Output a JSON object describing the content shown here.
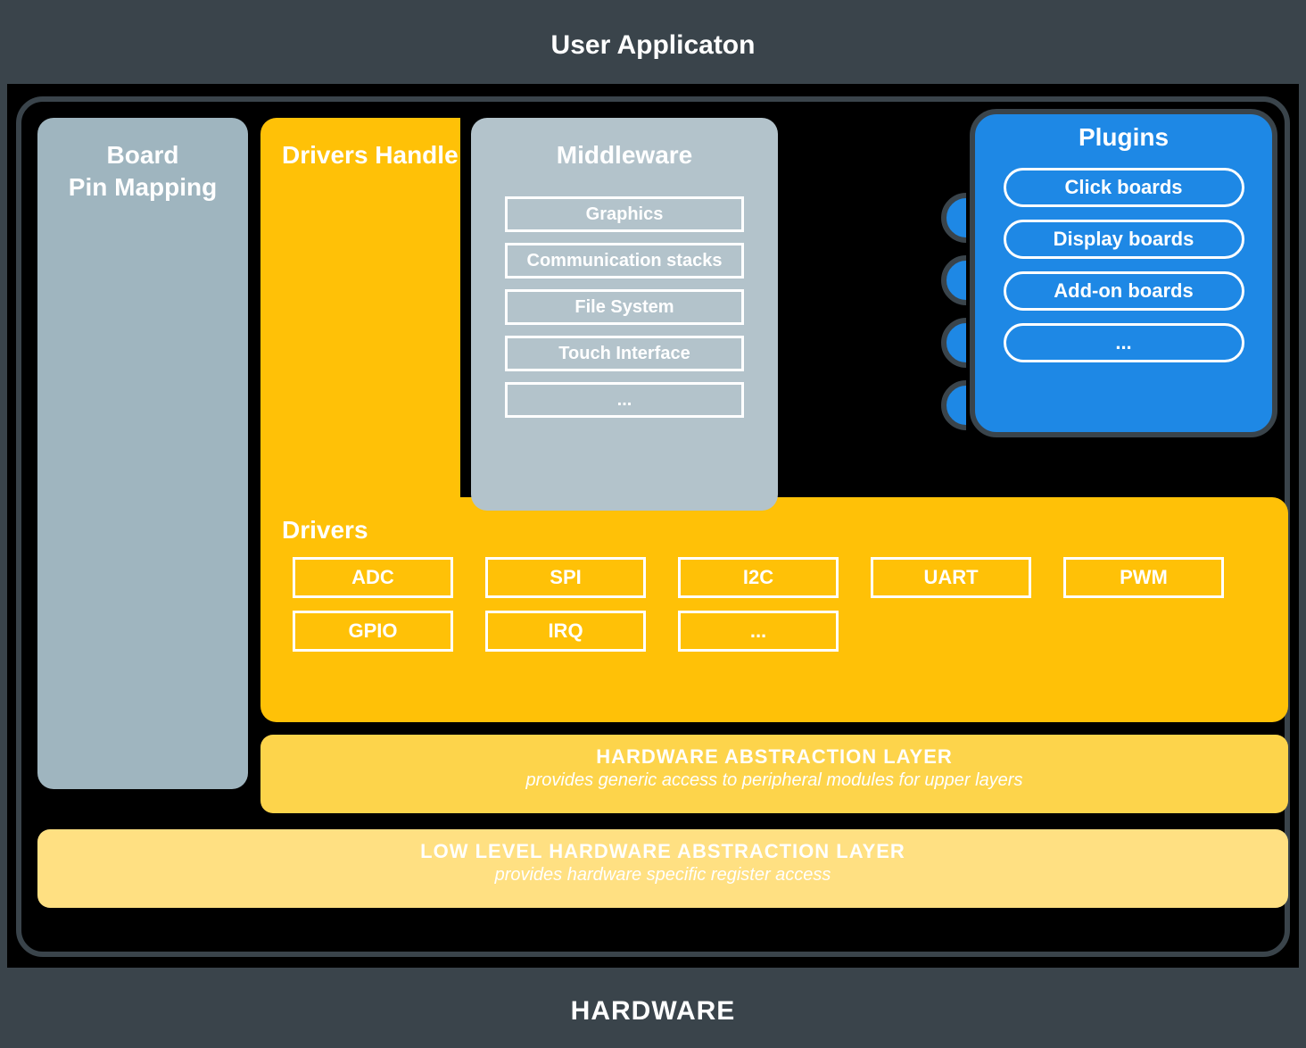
{
  "top_title": "User Applicaton",
  "bottom_title": "HARDWARE",
  "board_pin_mapping": {
    "line1": "Board",
    "line2": "Pin Mapping"
  },
  "drivers_handle_label": "Drivers Handle",
  "drivers_label": "Drivers",
  "drivers": [
    "ADC",
    "SPI",
    "I2C",
    "UART",
    "PWM",
    "GPIO",
    "IRQ",
    "..."
  ],
  "middleware": {
    "title": "Middleware",
    "items": [
      "Graphics",
      "Communication stacks",
      "File System",
      "Touch Interface",
      "..."
    ]
  },
  "plugins": {
    "title": "Plugins",
    "items": [
      "Click boards",
      "Display boards",
      "Add-on boards",
      "..."
    ]
  },
  "hal": {
    "title": "HARDWARE ABSTRACTION LAYER",
    "subtitle": "provides generic access to peripheral modules for upper layers"
  },
  "llhal": {
    "title": "LOW LEVEL HARDWARE ABSTRACTION LAYER",
    "subtitle": "provides hardware specific register access"
  },
  "colors": {
    "background": "#3a444b",
    "stage": "#000000",
    "drivers": "#ffc107",
    "hal": "#fdd44b",
    "llhal": "#ffe082",
    "middleware": "#b3c3cb",
    "board_pin": "#9fb5bf",
    "plugins": "#1e88e5"
  }
}
